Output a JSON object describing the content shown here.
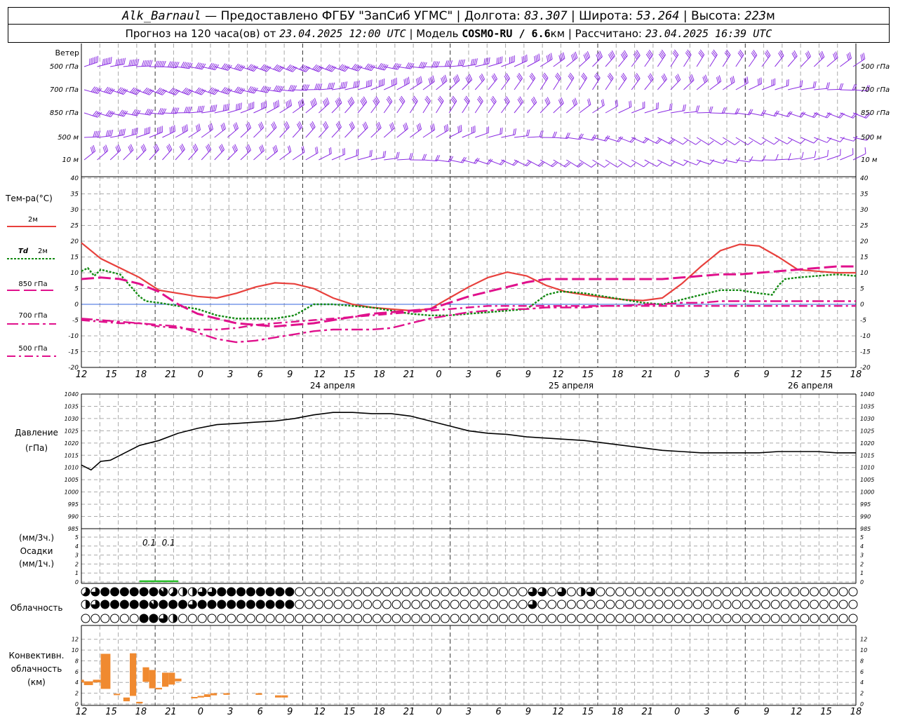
{
  "header": {
    "station": "Alk_Barnaul",
    "dash": " — ",
    "provided": "Предоставлено ФГБУ \"ЗапСиб УГМС\"",
    "sep": " | ",
    "lon_label": "Долгота: ",
    "lon": "83.307",
    "lat_label": "Широта: ",
    "lat": "53.264",
    "alt_label": "Высота: ",
    "alt": "223",
    "alt_unit": "м",
    "forecast_label": "Прогноз на 120 часа(ов)  от ",
    "forecast_time": "23.04.2025 12:00 UTC",
    "model_label": " | Модель ",
    "model": "COSMO-RU / 6.6",
    "model_unit": "км",
    "calc_label": " | Рассчитано: ",
    "calc_time": "23.04.2025 16:39 UTC"
  },
  "labels": {
    "wind": "Ветер",
    "temp": "Тем-ра(°С)",
    "t2m": "2м",
    "td": "Td",
    "td2m": "2м",
    "p850": "850 гПа",
    "p700": "700 гПа",
    "p500": "500 гПа",
    "pressure": "Давление",
    "pressure_unit": "(гПа)",
    "precip_3h": "(мм/3ч.)",
    "precip": "Осадки",
    "precip_1h": "(мм/1ч.)",
    "cloud": "Облачность",
    "conv1": "Конвективн.",
    "conv2": "облачность",
    "conv3": "(км)"
  },
  "colors": {
    "wind": "#8a2be2",
    "t2m": "#e8403c",
    "td": "#128a12",
    "levels": "#e0108c",
    "pressure": "#000000",
    "precip": "#22bb22",
    "conv": "#f08a30",
    "zero": "#3366dd",
    "grid": "#aaaaaa"
  },
  "chart_data": [
    {
      "type": "wind-barbs",
      "levels": [
        "500 гПа",
        "700 гПа",
        "850 гПа",
        "500 м",
        "10 м"
      ],
      "x": [
        0,
        120
      ],
      "speed_trend_ms": [
        28,
        26,
        24,
        22,
        20,
        18,
        16,
        14
      ]
    },
    {
      "type": "line",
      "name": "temperature",
      "ylim": [
        -20,
        40
      ],
      "yticks": [
        -20,
        -15,
        -10,
        -5,
        0,
        5,
        10,
        15,
        20,
        25,
        30,
        35,
        40
      ],
      "x_ticks": [
        "12",
        "15",
        "18",
        "21",
        "0",
        "3",
        "6",
        "9",
        "12",
        "15",
        "18",
        "21",
        "0",
        "3",
        "6",
        "9",
        "12",
        "15",
        "18",
        "21",
        "0",
        "3",
        "6",
        "9",
        "12",
        "15",
        "18"
      ],
      "days": [
        "24 апреля",
        "25 апреля",
        "26 апреля"
      ],
      "series": [
        {
          "name": "2м",
          "x": [
            0,
            3,
            6,
            9,
            12,
            15,
            18,
            21,
            24,
            27,
            30,
            33,
            36,
            39,
            42,
            45,
            48,
            51,
            54,
            57,
            60,
            63,
            66,
            69,
            72,
            75,
            78,
            81,
            84,
            87,
            90,
            93,
            96,
            99,
            102,
            105,
            108,
            111,
            114,
            117,
            120
          ],
          "values": [
            19.5,
            14.5,
            11.5,
            8.5,
            4.5,
            3.5,
            2.5,
            2.0,
            3.5,
            5.5,
            6.8,
            6.5,
            5.0,
            2.0,
            0.0,
            -1.0,
            -1.5,
            -2.0,
            -1.5,
            2.0,
            5.5,
            8.5,
            10.2,
            9.0,
            6.0,
            4.0,
            3.0,
            2.2,
            1.5,
            1.2,
            2.0,
            6.5,
            12.0,
            17.0,
            19.0,
            18.5,
            15.0,
            11.0,
            10.5,
            10.0,
            10.0
          ]
        },
        {
          "name": "Td 2м",
          "x": [
            0,
            1,
            2,
            3,
            6,
            9,
            10,
            12,
            15,
            18,
            21,
            24,
            27,
            30,
            33,
            36,
            37,
            39,
            42,
            45,
            48,
            51,
            54,
            57,
            60,
            63,
            66,
            69,
            72,
            74,
            75,
            78,
            81,
            84,
            87,
            90,
            93,
            96,
            99,
            102,
            105,
            107,
            108,
            109,
            111,
            114,
            117,
            120
          ],
          "values": [
            10.5,
            11.5,
            9.0,
            11.0,
            9.5,
            2.5,
            1.0,
            0.5,
            -0.5,
            -1.5,
            -3.5,
            -4.5,
            -4.5,
            -4.5,
            -3.5,
            0.0,
            0.0,
            0.0,
            -0.5,
            -1.0,
            -2.0,
            -3.0,
            -3.5,
            -3.5,
            -3.0,
            -2.5,
            -2.0,
            -1.5,
            3.0,
            4.0,
            4.0,
            3.5,
            2.5,
            1.5,
            0.5,
            0.0,
            1.5,
            3.0,
            4.5,
            4.5,
            3.5,
            3.0,
            6.0,
            8.0,
            8.5,
            9.0,
            9.5,
            9.0
          ]
        },
        {
          "name": "850 гПа",
          "x": [
            0,
            3,
            6,
            9,
            12,
            15,
            18,
            21,
            24,
            27,
            30,
            33,
            36,
            39,
            42,
            45,
            48,
            51,
            54,
            57,
            60,
            63,
            66,
            69,
            72,
            75,
            78,
            81,
            84,
            87,
            90,
            93,
            96,
            99,
            102,
            105,
            108,
            111,
            114,
            117,
            120
          ],
          "values": [
            8.0,
            8.5,
            8.0,
            6.5,
            4.0,
            0.0,
            -3.0,
            -4.5,
            -6.0,
            -6.5,
            -7.0,
            -6.5,
            -6.0,
            -5.0,
            -4.0,
            -3.0,
            -2.5,
            -2.0,
            -1.5,
            0.5,
            2.5,
            4.0,
            5.5,
            7.0,
            8.0,
            8.0,
            8.0,
            8.0,
            8.0,
            8.0,
            8.0,
            8.5,
            9.0,
            9.5,
            9.5,
            10.0,
            10.5,
            11.0,
            11.5,
            12.0,
            12.0
          ]
        },
        {
          "name": "700 гПа",
          "x": [
            0,
            3,
            6,
            9,
            12,
            15,
            18,
            21,
            24,
            27,
            30,
            33,
            36,
            39,
            42,
            45,
            48,
            51,
            54,
            57,
            60,
            63,
            66,
            69,
            72,
            75,
            78,
            81,
            84,
            87,
            90,
            93,
            96,
            99,
            102,
            105,
            108,
            111,
            114,
            117,
            120
          ],
          "values": [
            -4.5,
            -5.0,
            -5.5,
            -6.0,
            -6.5,
            -7.0,
            -9.0,
            -11.0,
            -12.0,
            -11.5,
            -10.5,
            -9.5,
            -8.5,
            -8.0,
            -8.0,
            -8.0,
            -7.5,
            -6.0,
            -4.5,
            -3.5,
            -2.5,
            -2.0,
            -1.5,
            -1.5,
            -1.0,
            -1.0,
            -1.0,
            -0.5,
            -0.5,
            0.0,
            0.0,
            0.5,
            0.5,
            1.0,
            1.0,
            1.0,
            1.0,
            1.0,
            1.0,
            1.0,
            1.0
          ]
        },
        {
          "name": "500 гПа",
          "x": [
            0,
            3,
            6,
            9,
            12,
            15,
            18,
            21,
            24,
            27,
            30,
            33,
            36,
            39,
            42,
            45,
            48,
            51,
            54,
            57,
            60,
            63,
            66,
            69,
            72,
            75,
            78,
            81,
            84,
            87,
            90,
            93,
            96,
            99,
            102,
            105,
            108,
            111,
            114,
            117,
            120
          ],
          "values": [
            -5.0,
            -5.5,
            -6.0,
            -6.0,
            -7.0,
            -7.5,
            -8.0,
            -8.0,
            -7.5,
            -6.5,
            -6.0,
            -5.5,
            -5.0,
            -4.5,
            -4.0,
            -3.5,
            -3.0,
            -2.5,
            -2.0,
            -1.5,
            -1.0,
            -0.5,
            -0.5,
            -0.5,
            -0.5,
            -0.5,
            -0.5,
            -0.5,
            -0.5,
            -0.5,
            -0.5,
            -0.5,
            -0.5,
            -0.5,
            -0.5,
            -0.5,
            -0.5,
            -0.5,
            -0.5,
            -0.5,
            -0.5
          ]
        }
      ]
    },
    {
      "type": "line",
      "name": "pressure",
      "ylim": [
        985,
        1040
      ],
      "yticks": [
        985,
        990,
        995,
        1000,
        1005,
        1010,
        1015,
        1020,
        1025,
        1030,
        1035,
        1040
      ],
      "x": [
        0,
        1.5,
        3,
        4.5,
        6,
        9,
        12,
        15,
        18,
        21,
        24,
        27,
        30,
        33,
        36,
        39,
        42,
        45,
        48,
        51,
        54,
        57,
        60,
        63,
        66,
        69,
        72,
        75,
        78,
        81,
        84,
        87,
        90,
        93,
        96,
        99,
        102,
        105,
        108,
        111,
        114,
        117,
        120
      ],
      "values": [
        1011,
        1009,
        1012.5,
        1013,
        1015,
        1019,
        1021,
        1024,
        1026,
        1027.5,
        1028,
        1028.5,
        1029,
        1030,
        1031.5,
        1032.5,
        1032.5,
        1032,
        1032,
        1031,
        1029,
        1027,
        1025,
        1024,
        1023.5,
        1022.5,
        1022,
        1021.5,
        1021,
        1020,
        1019,
        1018,
        1017,
        1016.5,
        1016,
        1016,
        1016,
        1016,
        1016.5,
        1016.5,
        1016.5,
        1016,
        1016
      ]
    },
    {
      "type": "bar",
      "name": "precipitation",
      "ylim": [
        0,
        5
      ],
      "yticks": [
        0,
        1,
        2,
        3,
        4,
        5
      ],
      "x": [
        10.5,
        13.5
      ],
      "values_mm_3h": [
        0.1,
        0.1
      ],
      "labels": [
        "0.1",
        "0.1"
      ]
    },
    {
      "type": "table",
      "name": "cloud-cover",
      "rows": 3,
      "note": "octas: 0 clear, 8 overcast",
      "row_high": [
        5,
        6,
        8,
        8,
        8,
        8,
        8,
        8,
        7,
        5,
        4,
        4,
        6,
        6,
        8,
        8,
        8,
        8,
        8,
        8,
        8,
        8,
        0,
        0,
        0,
        0,
        0,
        0,
        0,
        0,
        0,
        0,
        0,
        0,
        0,
        0,
        0,
        0,
        0,
        0,
        0,
        0,
        0,
        0,
        0,
        0,
        6,
        6,
        0,
        6,
        0,
        4,
        6,
        0,
        0,
        0,
        0,
        0,
        0,
        0,
        0,
        0,
        0,
        0,
        0,
        0,
        0,
        0,
        0,
        0,
        0,
        0,
        0,
        0,
        0,
        0,
        0,
        0,
        0,
        0
      ],
      "row_mid": [
        4,
        6,
        8,
        8,
        8,
        8,
        8,
        7,
        8,
        8,
        8,
        6,
        8,
        8,
        8,
        8,
        8,
        8,
        8,
        8,
        8,
        8,
        0,
        0,
        0,
        0,
        0,
        0,
        0,
        0,
        0,
        0,
        0,
        0,
        0,
        0,
        0,
        0,
        0,
        0,
        0,
        0,
        0,
        0,
        0,
        0,
        6,
        0,
        0,
        0,
        0,
        0,
        0,
        0,
        0,
        0,
        0,
        0,
        0,
        0,
        0,
        0,
        0,
        0,
        0,
        0,
        0,
        0,
        0,
        0,
        0,
        0,
        0,
        0,
        0,
        0,
        0,
        0,
        0,
        0
      ],
      "row_low": [
        0,
        0,
        0,
        0,
        0,
        0,
        8,
        8,
        6,
        4,
        0,
        0,
        0,
        0,
        0,
        0,
        0,
        0,
        0,
        0,
        0,
        0,
        0,
        0,
        0,
        0,
        0,
        0,
        0,
        0,
        0,
        0,
        0,
        0,
        0,
        0,
        0,
        0,
        0,
        0,
        0,
        0,
        0,
        0,
        0,
        0,
        0,
        0,
        0,
        0,
        0,
        0,
        0,
        0,
        0,
        0,
        0,
        0,
        0,
        0,
        0,
        0,
        0,
        0,
        0,
        0,
        0,
        0,
        0,
        0,
        0,
        0,
        0,
        0,
        0,
        0,
        0,
        0,
        0,
        0
      ]
    },
    {
      "type": "bar",
      "name": "convective-cloud",
      "ylim": [
        0,
        13
      ],
      "yticks": [
        0,
        2,
        4,
        6,
        8,
        10,
        12
      ],
      "bars": [
        {
          "x0": 0,
          "x1": 0.4,
          "bottom": 4,
          "top": 4.5
        },
        {
          "x0": 0.4,
          "x1": 1.8,
          "bottom": 3.5,
          "top": 4.2
        },
        {
          "x0": 1.8,
          "x1": 3,
          "bottom": 4,
          "top": 4.5
        },
        {
          "x0": 3,
          "x1": 4.5,
          "bottom": 2.8,
          "top": 9.3
        },
        {
          "x0": 5,
          "x1": 6,
          "bottom": 1.9,
          "top": 1.9
        },
        {
          "x0": 6.5,
          "x1": 7.5,
          "bottom": 0.5,
          "top": 1.2
        },
        {
          "x0": 7.5,
          "x1": 8.5,
          "bottom": 1.5,
          "top": 9.4
        },
        {
          "x0": 8.5,
          "x1": 9.5,
          "bottom": 0.1,
          "top": 0.4
        },
        {
          "x0": 9.5,
          "x1": 10.5,
          "bottom": 4.1,
          "top": 6.8
        },
        {
          "x0": 10.5,
          "x1": 11.5,
          "bottom": 2.9,
          "top": 6.3
        },
        {
          "x0": 11.5,
          "x1": 12.5,
          "bottom": 2.7,
          "top": 3.0
        },
        {
          "x0": 12.5,
          "x1": 13.5,
          "bottom": 3.2,
          "top": 5.8
        },
        {
          "x0": 13.5,
          "x1": 14.5,
          "bottom": 3.6,
          "top": 5.8
        },
        {
          "x0": 14.5,
          "x1": 15.5,
          "bottom": 4.2,
          "top": 4.7
        },
        {
          "x0": 17,
          "x1": 18,
          "bottom": 1.1,
          "top": 1.3
        },
        {
          "x0": 18,
          "x1": 19,
          "bottom": 1.2,
          "top": 1.5
        },
        {
          "x0": 19,
          "x1": 20,
          "bottom": 1.3,
          "top": 1.8
        },
        {
          "x0": 20,
          "x1": 21,
          "bottom": 1.6,
          "top": 2.0
        },
        {
          "x0": 22,
          "x1": 23,
          "bottom": 1.7,
          "top": 2.0
        },
        {
          "x0": 27,
          "x1": 28,
          "bottom": 1.7,
          "top": 2.0
        },
        {
          "x0": 30,
          "x1": 31,
          "bottom": 1.2,
          "top": 1.6
        },
        {
          "x0": 31,
          "x1": 32,
          "bottom": 1.2,
          "top": 1.6
        }
      ]
    }
  ]
}
